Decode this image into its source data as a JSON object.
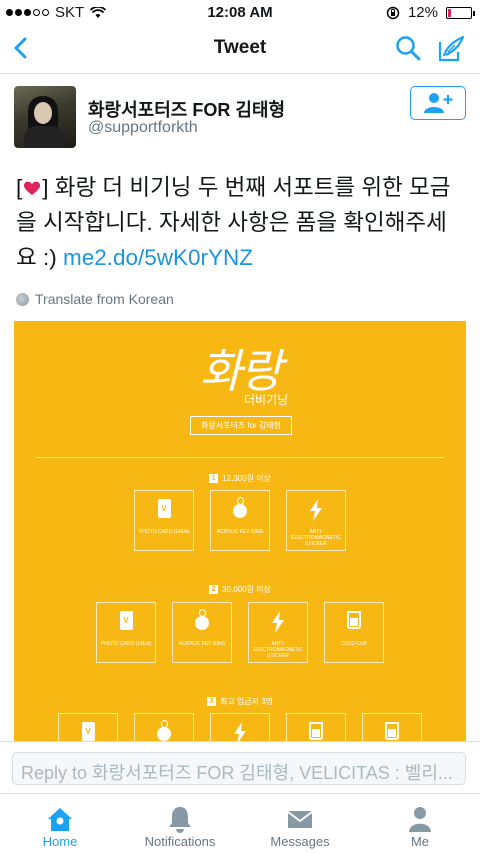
{
  "status_bar": {
    "carrier": "SKT",
    "time": "12:08 AM",
    "battery_percent": "12%",
    "battery_level": 0.12
  },
  "nav": {
    "title": "Tweet"
  },
  "tweet": {
    "author_name": "화랑서포터즈 FOR 김태형",
    "author_handle": "@supportforkth",
    "text_before_emoji": "[",
    "text_after_emoji": "] 화랑 더 비기닝 두 번째 서포트를 위한 모금을 시작합니다. 자세한 사항은 폼을 확인해주세요 :) ",
    "link": "me2.do/5wK0rYNZ",
    "translate_label": "Translate from Korean"
  },
  "media": {
    "logo_main": "화랑",
    "logo_sub": "더비기닝",
    "tag": "화랑서포터즈 for 김태형",
    "tiers": [
      {
        "number": "1",
        "label": "12,300원 이상",
        "items": [
          {
            "icon": "photo-card-icon",
            "label": "PHOTO CARD (14EA)"
          },
          {
            "icon": "key-ring-icon",
            "label": "ACRYLIC KEY RING"
          },
          {
            "icon": "sticker-icon",
            "label": "ANTI-ELECTROMAGNETIC STICKER"
          }
        ]
      },
      {
        "number": "2",
        "label": "30,000원 이상",
        "items": [
          {
            "icon": "photo-card-icon",
            "label": "PHOTO CARD (14EA)"
          },
          {
            "icon": "key-ring-icon",
            "label": "ACRYLIC KEY RING"
          },
          {
            "icon": "sticker-icon",
            "label": "ANTI-ELECTROMAGNETIC STICKER"
          },
          {
            "icon": "cup-icon",
            "label": "COLD CUP"
          }
        ]
      },
      {
        "number": "3",
        "label": "최고 입금자 3명",
        "items": []
      }
    ]
  },
  "reply": {
    "placeholder": "Reply to 화랑서포터즈 FOR 김태형, VELICITAS : 벨리..."
  },
  "tabs": [
    {
      "label": "Home",
      "icon": "home-icon",
      "active": true
    },
    {
      "label": "Notifications",
      "icon": "bell-icon",
      "active": false
    },
    {
      "label": "Messages",
      "icon": "envelope-icon",
      "active": false
    },
    {
      "label": "Me",
      "icon": "person-icon",
      "active": false
    }
  ],
  "colors": {
    "accent": "#1da1f2",
    "link": "#1b95e0",
    "media_bg": "#f8b814",
    "heart": "#e0245e"
  }
}
